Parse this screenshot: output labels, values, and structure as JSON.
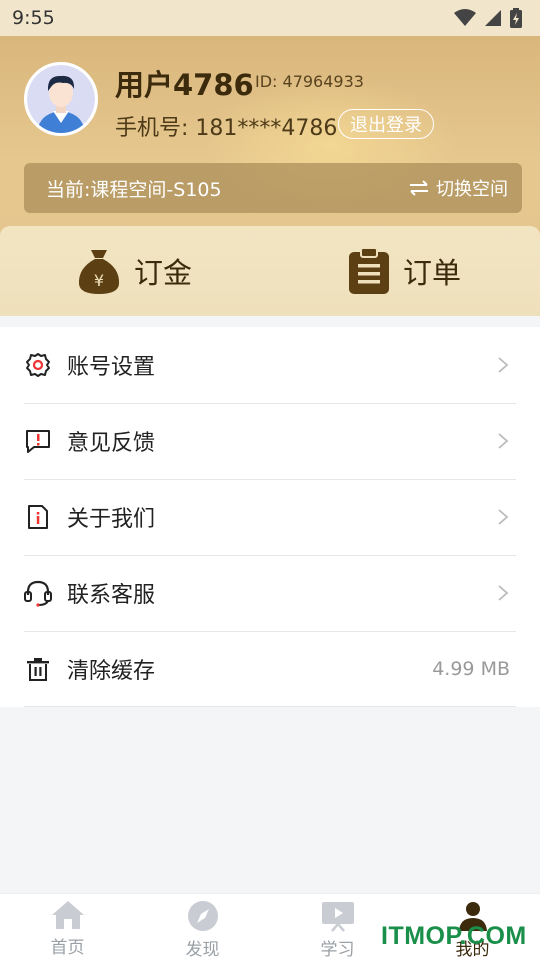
{
  "status_bar": {
    "time": "9:55"
  },
  "profile": {
    "username": "用户4786",
    "user_id": "ID: 47964933",
    "phone": "手机号: 181****4786",
    "logout_label": "退出登录",
    "current_space": "当前:课程空间-S105",
    "switch_space_label": "切换空间"
  },
  "quick_actions": [
    {
      "label": "订金",
      "icon": "money-bag-icon"
    },
    {
      "label": "订单",
      "icon": "clipboard-icon"
    }
  ],
  "menu": [
    {
      "label": "账号设置",
      "icon": "gear-icon",
      "value": ""
    },
    {
      "label": "意见反馈",
      "icon": "feedback-icon",
      "value": ""
    },
    {
      "label": "关于我们",
      "icon": "info-doc-icon",
      "value": ""
    },
    {
      "label": "联系客服",
      "icon": "headset-icon",
      "value": ""
    },
    {
      "label": "清除缓存",
      "icon": "trash-icon",
      "value": "4.99 MB"
    }
  ],
  "tabs": [
    {
      "label": "首页",
      "icon": "home-icon",
      "active": false
    },
    {
      "label": "发现",
      "icon": "compass-icon",
      "active": false
    },
    {
      "label": "学习",
      "icon": "play-board-icon",
      "active": false
    },
    {
      "label": "我的",
      "icon": "person-icon",
      "active": true
    }
  ],
  "watermark": "ITMOP.COM",
  "colors": {
    "accent_dark": "#3b2a0c",
    "hero": "#e2c188",
    "muted": "#9aa0a6"
  }
}
